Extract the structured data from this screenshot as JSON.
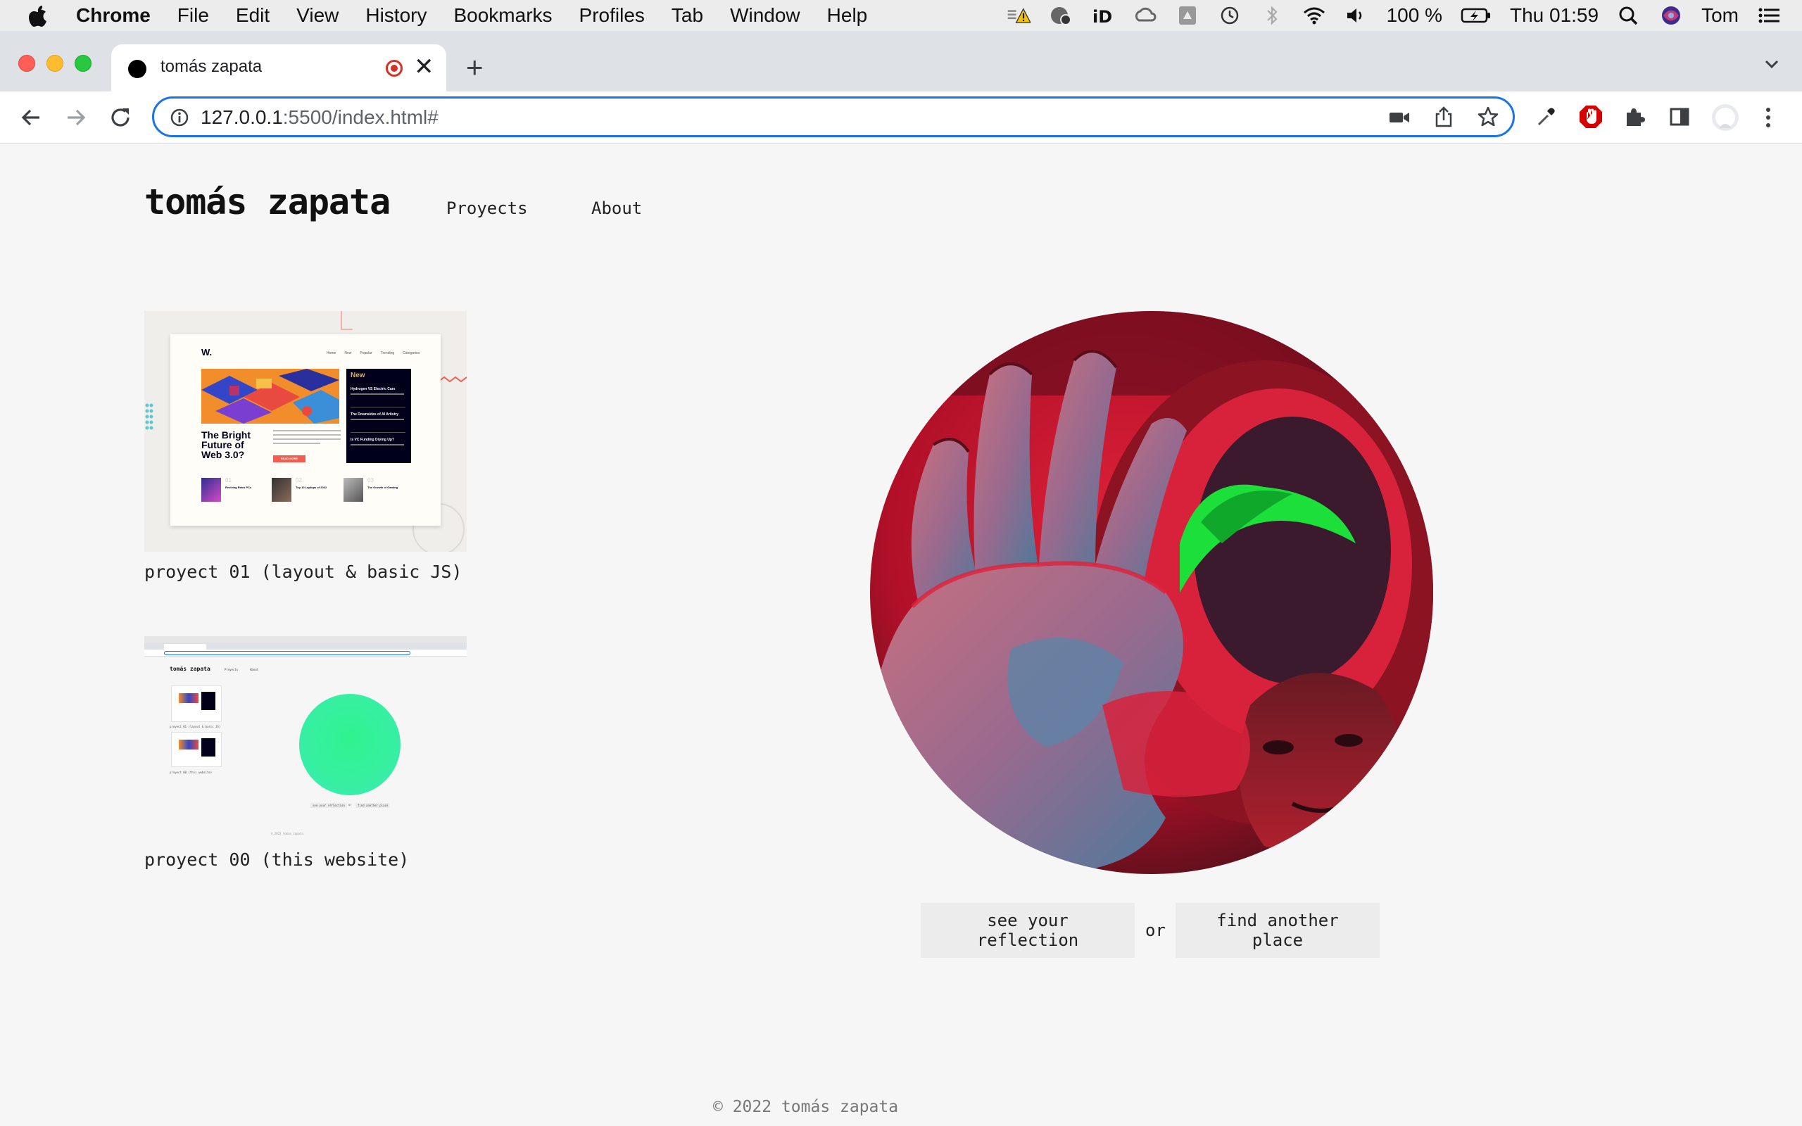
{
  "menubar": {
    "app": "Chrome",
    "items": [
      "File",
      "Edit",
      "View",
      "History",
      "Bookmarks",
      "Profiles",
      "Tab",
      "Window",
      "Help"
    ],
    "battery": "100 %",
    "clock": "Thu 01:59",
    "user": "Tom",
    "status_icons": [
      "battery-warning-icon",
      "monitor-icon",
      "id-icon",
      "creative-cloud-icon",
      "drive-icon",
      "time-machine-icon",
      "bluetooth-icon",
      "wifi-icon",
      "volume-icon",
      "battery-icon",
      "spotlight-icon",
      "siri-icon",
      "control-center-icon"
    ]
  },
  "browser": {
    "tab_title": "tomás zapata",
    "url_host": "127.0.0.1",
    "url_path": ":5500/index.html#",
    "colors": {
      "tabstrip": "#dee1e6",
      "focus_ring": "#1a73e8",
      "recording": "#d93025"
    }
  },
  "site": {
    "title": "tomás zapata",
    "nav": [
      "Proyects",
      "About"
    ],
    "projects": [
      {
        "caption": "proyect 01 (layout & basic JS)"
      },
      {
        "caption": "proyect 00 (this website)"
      }
    ],
    "buttons": {
      "reflection": "see your reflection",
      "or": "or",
      "another_place": "find another place"
    },
    "footer": "© 2022 tomás zapata"
  },
  "thumb01": {
    "logo": "W.",
    "nav": [
      "Home",
      "New",
      "Popular",
      "Trending",
      "Categories"
    ],
    "headline": "The Bright Future of Web 3.0?",
    "read_more": "READ MORE",
    "new_label": "New",
    "new_items": [
      "Hydrogen VS Electric Cars",
      "The Downsides of AI Artistry",
      "Is VC Funding Drying Up?"
    ],
    "bottom": [
      {
        "num": "01",
        "title": "Reviving Retro PCs"
      },
      {
        "num": "02",
        "title": "Top 10 Laptops of 2022"
      },
      {
        "num": "03",
        "title": "The Growth of Gaming"
      }
    ],
    "colors": {
      "accent": "#f15e50",
      "dark": "#00001a",
      "gold": "#e9ab53"
    }
  },
  "thumb00": {
    "title": "tomás zapata",
    "nav": [
      "Proyects",
      "About"
    ],
    "captions": [
      "proyect 01 (layout & basic JS)",
      "proyect 00 (this website)"
    ],
    "buttons": [
      "see your reflection",
      "or",
      "find another place"
    ],
    "footer": "© 2022 tomás zapata",
    "orb_color": "#2ff28f"
  }
}
